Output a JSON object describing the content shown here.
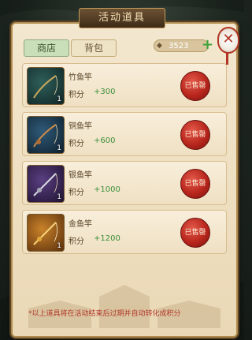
{
  "title": "活动道具",
  "tabs": [
    {
      "label": "商店",
      "active": true
    },
    {
      "label": "背包",
      "active": false
    }
  ],
  "currency": {
    "value": "3523",
    "icon": "coin-icon"
  },
  "close_label": "✕",
  "add_label": "+",
  "items": [
    {
      "name": "竹鱼竿",
      "points_label": "积分",
      "points": "+300",
      "qty": "1",
      "status": "已售罄",
      "frame": "#2f5f5a",
      "frame2": "#0f2524"
    },
    {
      "name": "铜鱼竿",
      "points_label": "积分",
      "points": "+600",
      "qty": "1",
      "status": "已售罄",
      "frame": "#2f5a78",
      "frame2": "#0e1f2d"
    },
    {
      "name": "银鱼竿",
      "points_label": "积分",
      "points": "+1000",
      "qty": "1",
      "status": "已售罄",
      "frame": "#5a3f82",
      "frame2": "#1e1230"
    },
    {
      "name": "金鱼竿",
      "points_label": "积分",
      "points": "+1200",
      "qty": "1",
      "status": "已售罄",
      "frame": "#c9822a",
      "frame2": "#5a2f0c"
    }
  ],
  "note": "*以上道具将在活动结束后过期并自动转化成积分",
  "colors": {
    "accent": "#b1362a",
    "points": "#3b8f3a",
    "panel": "#f3e7cf"
  }
}
